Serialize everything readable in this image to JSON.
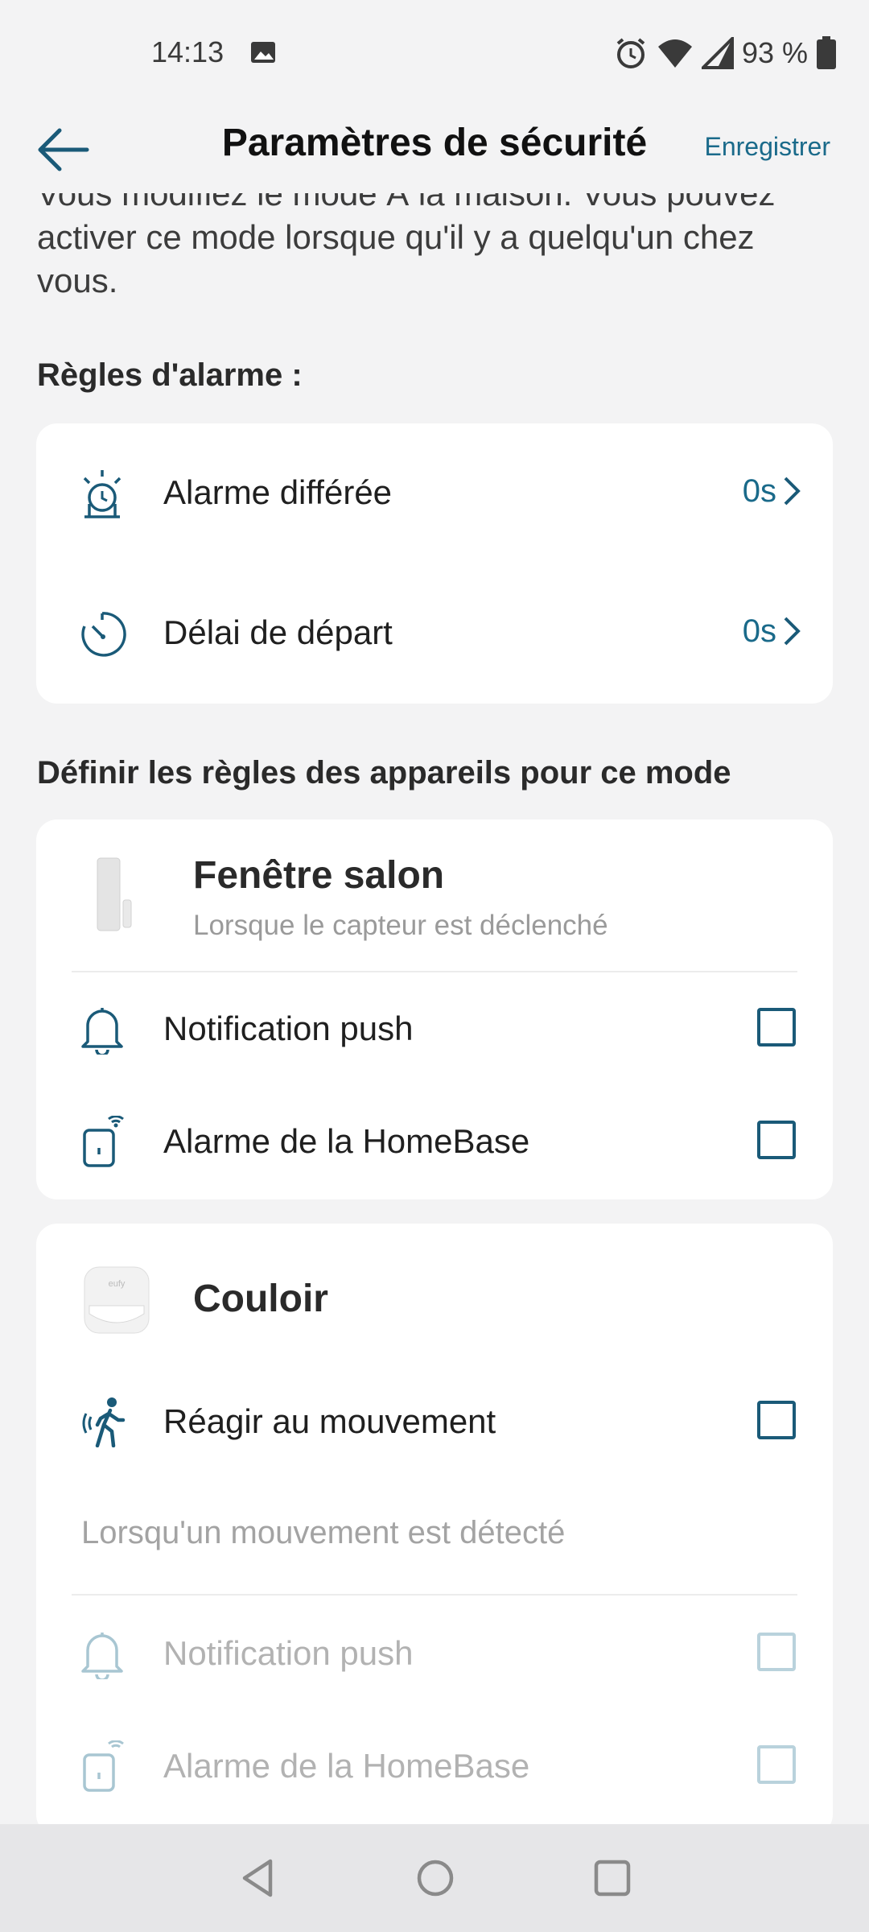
{
  "status_bar": {
    "time": "14:13",
    "battery": "93 %",
    "icons": [
      "image-icon",
      "alarm-clock-icon",
      "wifi-icon",
      "signal-icon",
      "battery-icon"
    ]
  },
  "header": {
    "title": "Paramètres de sécurité",
    "save_label": "Enregistrer"
  },
  "intro_text": "Vous modifiez le mode À la maison. Vous pouvez activer ce mode lorsque qu'il y a quelqu'un chez vous.",
  "alarm_rules": {
    "title": "Règles d'alarme :",
    "items": [
      {
        "label": "Alarme différée",
        "value": "0s",
        "icon": "delayed-alarm-icon"
      },
      {
        "label": "Délai de départ",
        "value": "0s",
        "icon": "timer-icon"
      }
    ]
  },
  "device_rules": {
    "title": "Définir les règles des appareils pour ce mode",
    "devices": [
      {
        "name": "Fenêtre salon",
        "subtitle": "Lorsque le capteur est déclenché",
        "options": [
          {
            "label": "Notification push",
            "icon": "bell-icon",
            "checked": false
          },
          {
            "label": "Alarme de la HomeBase",
            "icon": "homebase-icon",
            "checked": false
          }
        ]
      },
      {
        "name": "Couloir",
        "motion_option": {
          "label": "Réagir au mouvement",
          "checked": false
        },
        "hint": "Lorsqu'un mouvement est détecté",
        "options": [
          {
            "label": "Notification push",
            "icon": "bell-icon",
            "checked": false,
            "disabled": true
          },
          {
            "label": "Alarme de la HomeBase",
            "icon": "homebase-icon",
            "checked": false,
            "disabled": true
          }
        ]
      }
    ]
  },
  "colors": {
    "accent": "#1a6a8a",
    "background": "#f3f3f4",
    "card": "#ffffff"
  }
}
